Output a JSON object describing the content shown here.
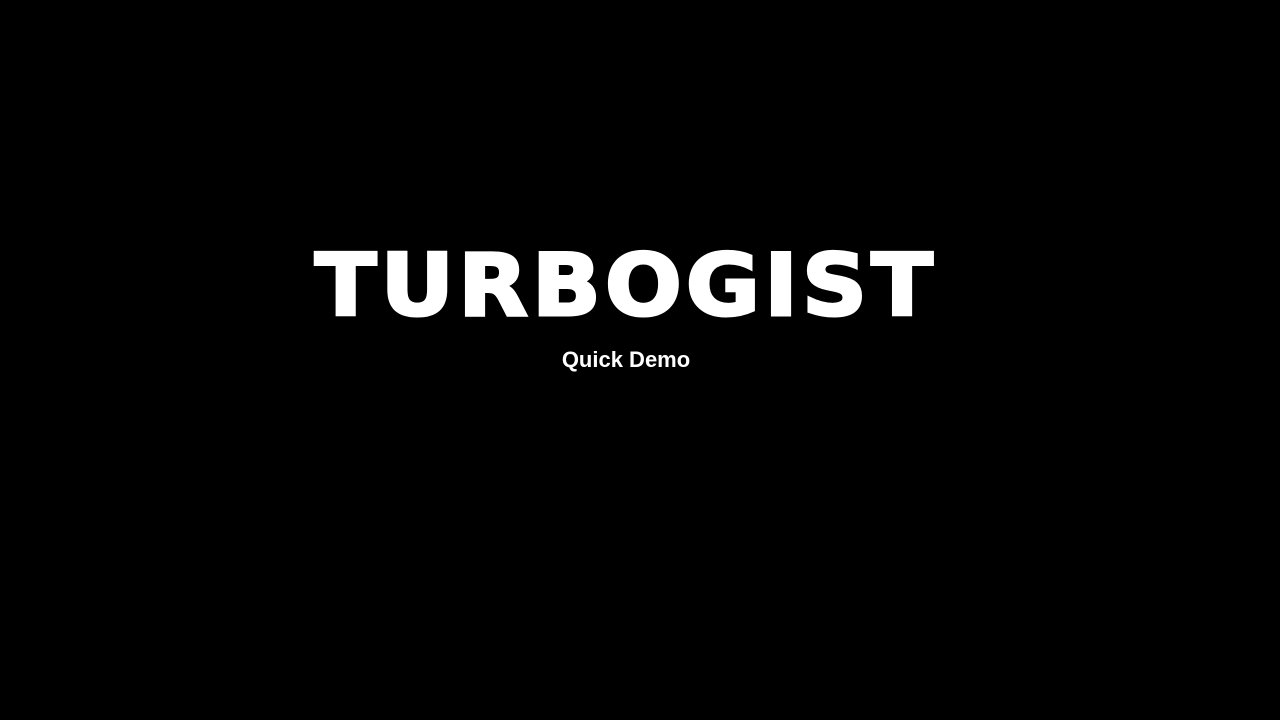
{
  "splash": {
    "title": "TURBOGIST",
    "subtitle": "Quick Demo"
  },
  "colors": {
    "background": "#000000",
    "text": "#ffffff"
  }
}
